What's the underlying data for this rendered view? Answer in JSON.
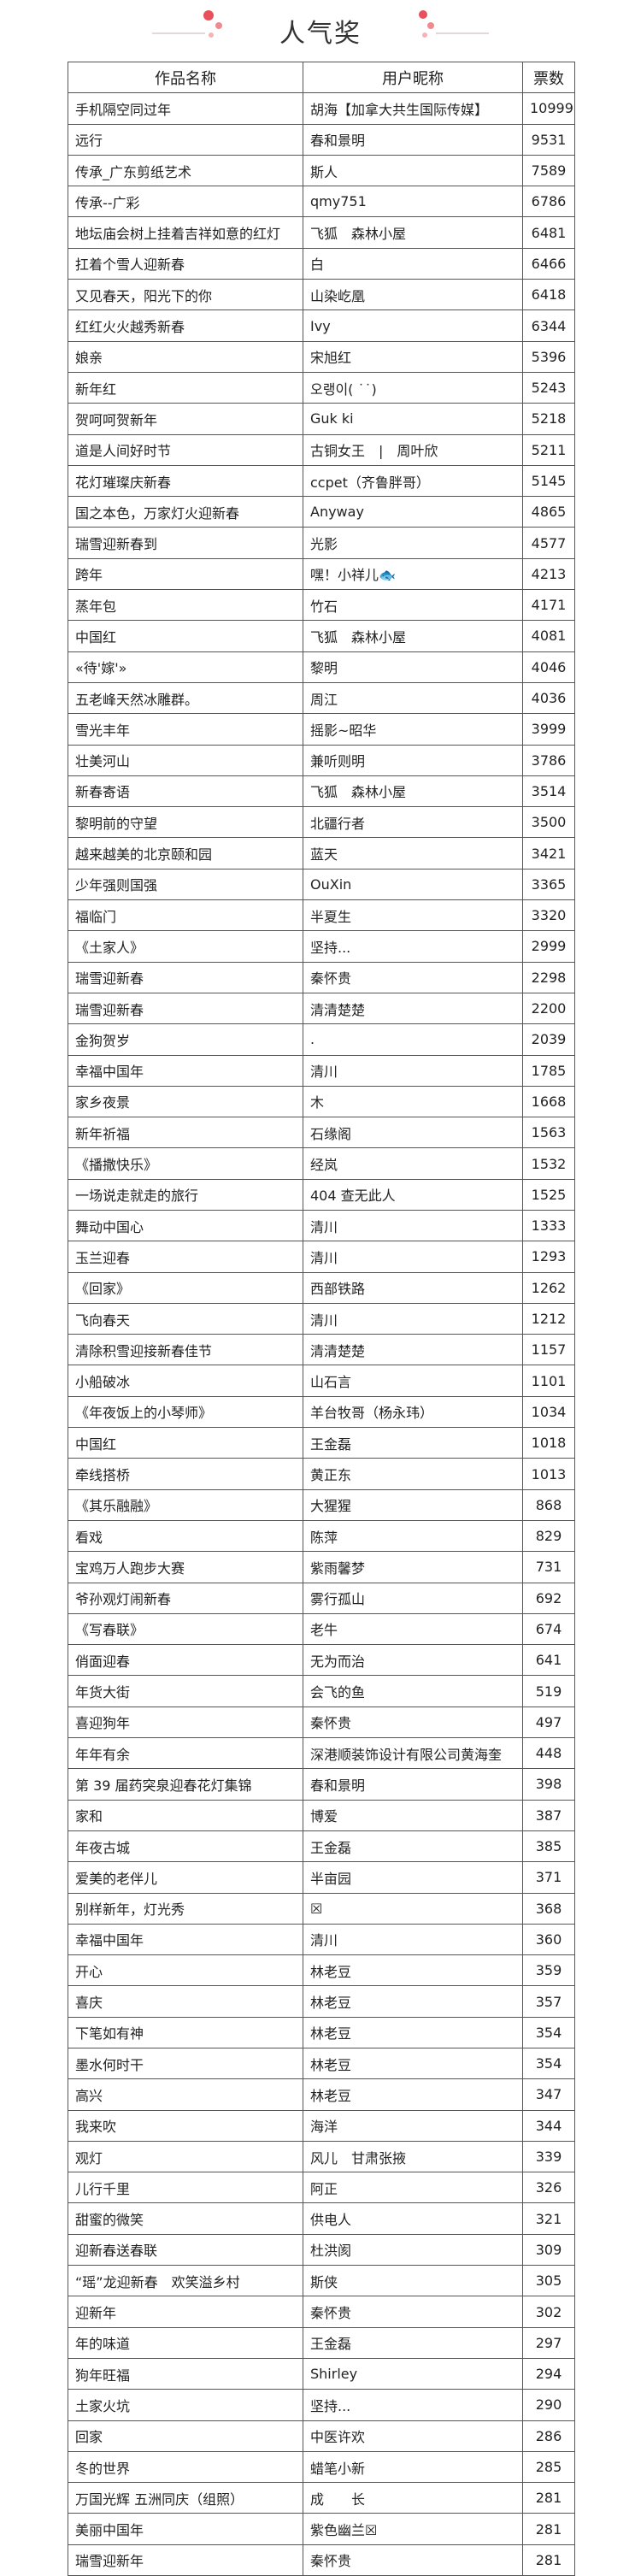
{
  "page": {
    "title": "人气奖"
  },
  "table": {
    "headers": [
      "作品名称",
      "用户昵称",
      "票数"
    ],
    "rows": [
      [
        "手机隔空同过年",
        "胡海【加拿大共生国际传媒】",
        "10999"
      ],
      [
        "远行",
        "春和景明",
        "9531"
      ],
      [
        "传承_广东剪纸艺术",
        "斯人",
        "7589"
      ],
      [
        "传承--广彩",
        "qmy751",
        "6786"
      ],
      [
        "地坛庙会树上挂着吉祥如意的红灯",
        "飞狐　森林小屋",
        "6481"
      ],
      [
        "扛着个雪人迎新春",
        "白",
        "6466"
      ],
      [
        "又见春天，阳光下的你",
        "山染屹凰",
        "6418"
      ],
      [
        "红红火火越秀新春",
        "Ivy",
        "6344"
      ],
      [
        "娘亲",
        "宋旭红",
        "5396"
      ],
      [
        "新年红",
        "오랭이( ˙˙)",
        "5243"
      ],
      [
        "贺呵呵贺新年",
        "Guk ki",
        "5218"
      ],
      [
        "道是人间好时节",
        "古铜女王　|　周叶欣",
        "5211"
      ],
      [
        "花灯璀璨庆新春",
        "ccpet（齐鲁胖哥）",
        "5145"
      ],
      [
        "国之本色，万家灯火迎新春",
        "Anyway",
        "4865"
      ],
      [
        "瑞雪迎新春到",
        "光影",
        "4577"
      ],
      [
        "跨年",
        "嘿！小祥儿🐟",
        "4213"
      ],
      [
        "蒸年包",
        "竹石",
        "4171"
      ],
      [
        "中国红",
        "飞狐　森林小屋",
        "4081"
      ],
      [
        "«待'嫁'»",
        "黎明",
        "4046"
      ],
      [
        "五老峰天然冰雕群。",
        "周江",
        "4036"
      ],
      [
        "雪光丰年",
        "摇影~昭华",
        "3999"
      ],
      [
        "壮美河山",
        "兼听则明",
        "3786"
      ],
      [
        "新春寄语",
        "飞狐　森林小屋",
        "3514"
      ],
      [
        "黎明前的守望",
        "北疆行者",
        "3500"
      ],
      [
        "越来越美的北京颐和园",
        "蓝天",
        "3421"
      ],
      [
        "少年强则国强",
        "OuXin",
        "3365"
      ],
      [
        "福临门",
        "半夏生",
        "3320"
      ],
      [
        "《土家人》",
        "坚持...",
        "2999"
      ],
      [
        "瑞雪迎新春",
        "秦怀贵",
        "2298"
      ],
      [
        "瑞雪迎新春",
        "清清楚楚",
        "2200"
      ],
      [
        "金狗贺岁",
        ".",
        "2039"
      ],
      [
        "幸福中国年",
        "清川",
        "1785"
      ],
      [
        "家乡夜景",
        "木",
        "1668"
      ],
      [
        "新年祈福",
        "石缘阁",
        "1563"
      ],
      [
        "《播撒快乐》",
        "经岚",
        "1532"
      ],
      [
        "一场说走就走的旅行",
        "404 查无此人",
        "1525"
      ],
      [
        "舞动中国心",
        "清川",
        "1333"
      ],
      [
        "玉兰迎春",
        "清川",
        "1293"
      ],
      [
        "《回家》",
        "西部铁路",
        "1262"
      ],
      [
        "飞向春天",
        "清川",
        "1212"
      ],
      [
        "清除积雪迎接新春佳节",
        "清清楚楚",
        "1157"
      ],
      [
        "小船破冰",
        "山石言",
        "1101"
      ],
      [
        "《年夜饭上的小琴师》",
        "羊台牧哥（杨永玮）",
        "1034"
      ],
      [
        "中国红",
        "王金磊",
        "1018"
      ],
      [
        "牵线搭桥",
        "黄正东",
        "1013"
      ],
      [
        "《其乐融融》",
        "大猩猩",
        "868"
      ],
      [
        "看戏",
        "陈萍",
        "829"
      ],
      [
        "宝鸡万人跑步大赛",
        "紫雨馨梦",
        "731"
      ],
      [
        "爷孙观灯闹新春",
        "雾行孤山",
        "692"
      ],
      [
        "《写春联》",
        "老牛",
        "674"
      ],
      [
        "俏面迎春",
        "无为而治",
        "641"
      ],
      [
        "年货大街",
        "会飞的鱼",
        "519"
      ],
      [
        "喜迎狗年",
        "秦怀贵",
        "497"
      ],
      [
        "年年有余",
        "深港顺装饰设计有限公司黄海奎",
        "448"
      ],
      [
        "第 39 届药突泉迎春花灯集锦",
        "春和景明",
        "398"
      ],
      [
        "家和",
        "博爱",
        "387"
      ],
      [
        "年夜古城",
        "王金磊",
        "385"
      ],
      [
        "爱美的老伴儿",
        "半亩园",
        "371"
      ],
      [
        "别样新年，灯光秀",
        "☒",
        "368"
      ],
      [
        "幸福中国年",
        "清川",
        "360"
      ],
      [
        "开心",
        "林老豆",
        "359"
      ],
      [
        "喜庆",
        "林老豆",
        "357"
      ],
      [
        "下笔如有神",
        "林老豆",
        "354"
      ],
      [
        "墨水何时干",
        "林老豆",
        "354"
      ],
      [
        "高兴",
        "林老豆",
        "347"
      ],
      [
        "我来吹",
        "海洋",
        "344"
      ],
      [
        "观灯",
        "风儿　甘肃张掖",
        "339"
      ],
      [
        "儿行千里",
        "阿正",
        "326"
      ],
      [
        "甜蜜的微笑",
        "供电人",
        "321"
      ],
      [
        "迎新春送春联",
        "杜洪阂",
        "309"
      ],
      [
        "“瑶”龙迎新春　欢笑溢乡村",
        "斯侠",
        "305"
      ],
      [
        "迎新年",
        "秦怀贵",
        "302"
      ],
      [
        "年的味道",
        "王金磊",
        "297"
      ],
      [
        "狗年旺福",
        "Shirley",
        "294"
      ],
      [
        "土家火坑",
        "坚持...",
        "290"
      ],
      [
        "回家",
        "中医许欢",
        "286"
      ],
      [
        "冬的世界",
        "蜡笔小新",
        "285"
      ],
      [
        "万国光辉 五洲同庆（组照）",
        "成　　长",
        "281"
      ],
      [
        "美丽中国年",
        "紫色幽兰☒",
        "281"
      ],
      [
        "瑞雪迎新年",
        "秦怀贵",
        "281"
      ]
    ]
  }
}
